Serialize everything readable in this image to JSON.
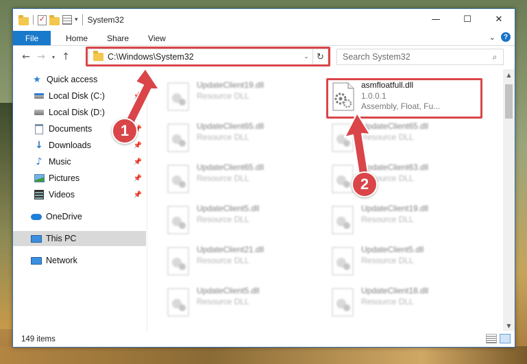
{
  "window": {
    "title": "System32",
    "controls": {
      "minimize": "—",
      "maximize": "☐",
      "close": "✕"
    }
  },
  "ribbon": {
    "tabs": [
      {
        "label": "File"
      },
      {
        "label": "Home"
      },
      {
        "label": "Share"
      },
      {
        "label": "View"
      }
    ]
  },
  "navigation": {
    "address": "C:\\Windows\\System32",
    "search_placeholder": "Search System32"
  },
  "sidebar": {
    "items": [
      {
        "label": "Quick access",
        "icon": "star-icon",
        "pinned": false
      },
      {
        "label": "Local Disk (C:)",
        "icon": "drive-icon",
        "pinned": true
      },
      {
        "label": "Local Disk (D:)",
        "icon": "drive-icon",
        "pinned": true
      },
      {
        "label": "Documents",
        "icon": "documents-icon",
        "pinned": true
      },
      {
        "label": "Downloads",
        "icon": "download-icon",
        "pinned": true
      },
      {
        "label": "Music",
        "icon": "music-icon",
        "pinned": true
      },
      {
        "label": "Pictures",
        "icon": "pictures-icon",
        "pinned": true
      },
      {
        "label": "Videos",
        "icon": "videos-icon",
        "pinned": true
      },
      {
        "label": "OneDrive",
        "icon": "onedrive-icon",
        "pinned": false
      },
      {
        "label": "This PC",
        "icon": "computer-icon",
        "pinned": false,
        "selected": true
      },
      {
        "label": "Network",
        "icon": "network-icon",
        "pinned": false
      }
    ]
  },
  "files": {
    "highlighted": {
      "name": "asmfloatfull.dll",
      "version": "1.0.0.1",
      "description": "Assembly, Float, Fu..."
    },
    "items": [
      {
        "name": "UpdateClient19.dll",
        "type": "Resource DLL"
      },
      {
        "name": "UpdateClient65.dll",
        "type": "Resource DLL"
      },
      {
        "name": "UpdateClient65.dll",
        "type": "Resource DLL"
      },
      {
        "name": "UpdateClient63.dll",
        "type": "Resource DLL"
      },
      {
        "name": "UpdateClient65.dll",
        "type": "Resource DLL"
      },
      {
        "name": "UpdateClient5.dll",
        "type": "Resource DLL"
      },
      {
        "name": "UpdateClient19.dll",
        "type": "Resource DLL"
      },
      {
        "name": "UpdateClient21.dll",
        "type": "Resource DLL"
      },
      {
        "name": "UpdateClient5.dll",
        "type": "Resource DLL"
      },
      {
        "name": "UpdateClient5.dll",
        "type": "Resource DLL"
      },
      {
        "name": "UpdateClient18.dll",
        "type": "Resource DLL"
      }
    ]
  },
  "status": {
    "item_count": "149 items"
  },
  "annotations": {
    "step1": "1",
    "step2": "2",
    "color": "#d94549"
  }
}
